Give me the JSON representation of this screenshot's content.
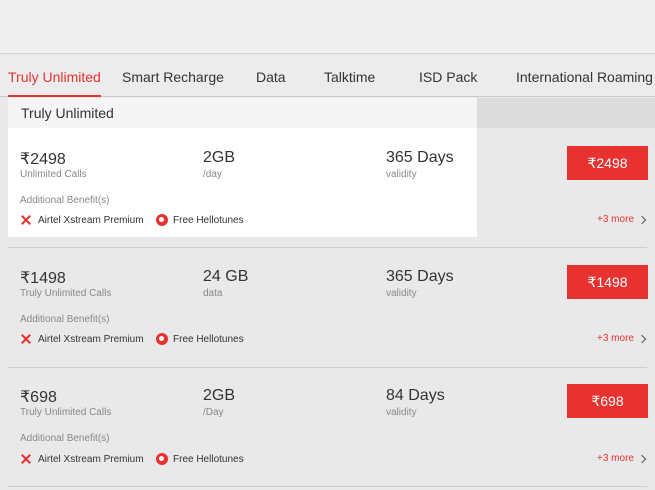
{
  "tabs": [
    {
      "label": "Truly Unlimited",
      "active": true
    },
    {
      "label": "Smart Recharge",
      "active": false
    },
    {
      "label": "Data",
      "active": false
    },
    {
      "label": "Talktime",
      "active": false
    },
    {
      "label": "ISD Pack",
      "active": false
    },
    {
      "label": "International Roaming",
      "active": false
    }
  ],
  "section_title": "Truly Unlimited",
  "accent_color": "#e8322f",
  "plans": [
    {
      "price": "₹2498",
      "price_sub": "Unlimited Calls",
      "data": "2GB",
      "data_sub": "/day",
      "validity": "365 Days",
      "validity_sub": "validity",
      "benefits_label": "Additional Benefit(s)",
      "benefits": [
        {
          "icon": "xstream-icon",
          "label": "Airtel Xstream Premium"
        },
        {
          "icon": "hellotunes-icon",
          "label": "Free Hellotunes"
        }
      ],
      "button": "₹2498",
      "more": "+3 more"
    },
    {
      "price": "₹1498",
      "price_sub": "Truly Unlimited Calls",
      "data": "24 GB",
      "data_sub": "data",
      "validity": "365 Days",
      "validity_sub": "validity",
      "benefits_label": "Additional Benefit(s)",
      "benefits": [
        {
          "icon": "xstream-icon",
          "label": "Airtel Xstream Premium"
        },
        {
          "icon": "hellotunes-icon",
          "label": "Free Hellotunes"
        }
      ],
      "button": "₹1498",
      "more": "+3 more"
    },
    {
      "price": "₹698",
      "price_sub": "Truly Unlimited Calls",
      "data": "2GB",
      "data_sub": "/Day",
      "validity": "84 Days",
      "validity_sub": "validity",
      "benefits_label": "Additional Benefit(s)",
      "benefits": [
        {
          "icon": "xstream-icon",
          "label": "Airtel Xstream Premium"
        },
        {
          "icon": "hellotunes-icon",
          "label": "Free Hellotunes"
        }
      ],
      "button": "₹698",
      "more": "+3 more"
    }
  ]
}
